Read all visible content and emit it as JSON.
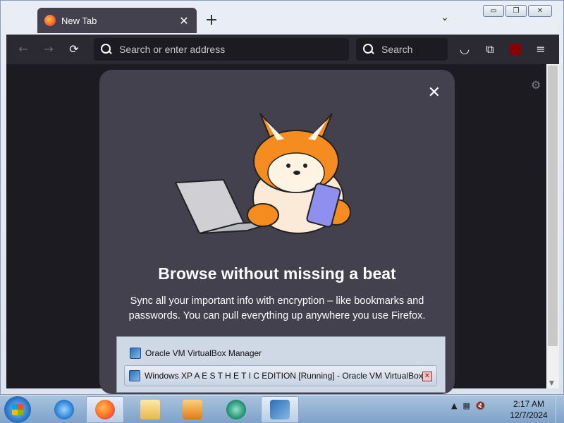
{
  "browser": {
    "tab": {
      "title": "New Tab"
    },
    "url_placeholder": "Search or enter address",
    "search_placeholder": "Search"
  },
  "window_controls": {
    "minimize": "▭",
    "restore": "❐",
    "close": "✕"
  },
  "card": {
    "heading": "Browse without missing a beat",
    "body": "Sync all your important info with encryption – like bookmarks and passwords. You can pull everything up anywhere you use Firefox."
  },
  "popup": {
    "items": [
      {
        "label": "Oracle VM VirtualBox Manager"
      },
      {
        "label": "Windows XP A E S T H E T I C EDITION [Running] - Oracle VM VirtualBox"
      }
    ]
  },
  "taskbar": {
    "time": "2:17 AM",
    "date": "12/7/2024"
  },
  "icons": {
    "back": "←",
    "forward": "→",
    "reload": "⟳",
    "pocket": "◡",
    "extensions": "⧉",
    "menu": "≡",
    "gear": "⚙",
    "new_tab": "+",
    "list_tabs": "⌄"
  }
}
